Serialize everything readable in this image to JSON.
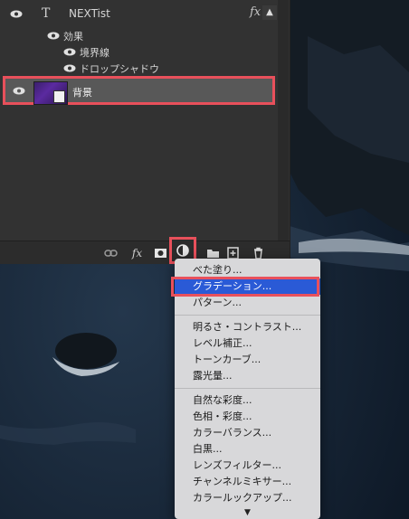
{
  "layers": {
    "text_layer_name": "NEXTist",
    "fx_badge": "fx",
    "collapse_icon": "chevron-up",
    "effects_label": "効果",
    "effect_1": "境界線",
    "effect_2": "ドロップシャドウ",
    "background_layer_name": "背景"
  },
  "panel_tools": {
    "link": "link-icon",
    "fx": "fx",
    "mask": "mask-icon",
    "adjustment": "adjustment-layer-icon",
    "group": "folder-icon",
    "new_layer": "new-layer-icon",
    "delete": "trash-icon"
  },
  "menu": {
    "group1": [
      "べた塗り...",
      "グラデーション...",
      "パターン..."
    ],
    "group2": [
      "明るさ・コントラスト...",
      "レベル補正...",
      "トーンカーブ...",
      "露光量..."
    ],
    "group3": [
      "自然な彩度...",
      "色相・彩度...",
      "カラーバランス...",
      "白黒...",
      "レンズフィルター...",
      "チャンネルミキサー...",
      "カラールックアップ..."
    ],
    "more_indicator": "▼"
  },
  "colors": {
    "highlight_frame": "#e8505b",
    "selected_item": "#2a5ad6",
    "panel": "#323232"
  }
}
